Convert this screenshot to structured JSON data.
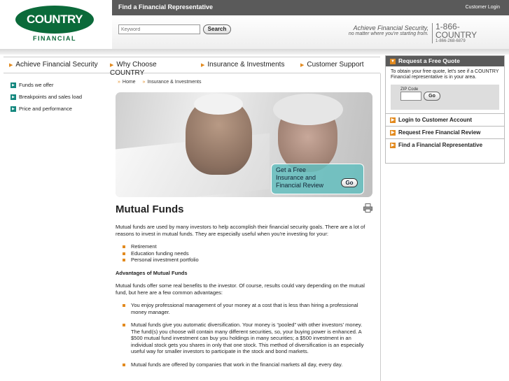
{
  "top_bar": {
    "title": "Find a Financial Representative",
    "login": "Customer Login"
  },
  "logo": {
    "name": "COUNTRY",
    "sub": "FINANCIAL"
  },
  "search": {
    "placeholder": "Keyword",
    "button": "Search"
  },
  "tagline": {
    "line1": "Achieve Financial Security,",
    "line2": "no matter where you're starting from."
  },
  "phone": {
    "line1": "1-866-",
    "line2": "COUNTRY",
    "line3": "1-866-268-6879"
  },
  "nav": {
    "items": [
      {
        "label": "Achieve Financial Security"
      },
      {
        "label": "Why Choose COUNTRY"
      },
      {
        "label": "Insurance & Investments"
      },
      {
        "label": "Customer Support"
      }
    ]
  },
  "sidebar": {
    "items": [
      {
        "label": "Funds we offer"
      },
      {
        "label": "Breakpoints and sales load"
      },
      {
        "label": "Price and performance"
      }
    ]
  },
  "breadcrumb": [
    "Home",
    "Insurance & Investments"
  ],
  "hero": {
    "promo_line1": "Get a Free",
    "promo_line2": "Insurance and",
    "promo_line3": "Financial Review",
    "go": "Go"
  },
  "quote_panel": {
    "title": "Request a Free Quote",
    "text": "To obtain your free quote, let's see if a COUNTRY Financial representative is in your area.",
    "zip_label": "ZIP Code",
    "go": "Go",
    "links": [
      {
        "label": "Login to Customer Account"
      },
      {
        "label": "Request Free Financial Review"
      },
      {
        "label": "Find a Financial Representative"
      }
    ]
  },
  "content": {
    "title": "Mutual Funds",
    "intro": "Mutual funds are used by many investors to help accomplish their financial security goals. There are a lot of reasons to invest in mutual funds. They are especially useful when you're investing for your:",
    "uses": [
      "Retirement",
      "Education funding needs",
      "Personal investment portfolio"
    ],
    "adv_heading": "Advantages of Mutual Funds",
    "adv_intro": "Mutual funds offer some real benefits to the investor. Of course, results could vary depending on the mutual fund, but here are a few common advantages:",
    "advantages": [
      "You enjoy professional management of your money at a cost that is less than hiring a professional money manager.",
      "Mutual funds give you automatic diversification. Your money is “pooled” with other investors' money. The fund(s) you choose will contain many different securities, so, your buying power is enhanced. A $500 mutual fund investment can buy you holdings in many securities; a $500 investment in an individual stock gets you shares in only that one stock. This method of diversification is an especially useful way for smaller investors to participate in the stock and bond markets.",
      "Mutual funds are offered by companies that work in the financial markets all day, every day."
    ]
  }
}
